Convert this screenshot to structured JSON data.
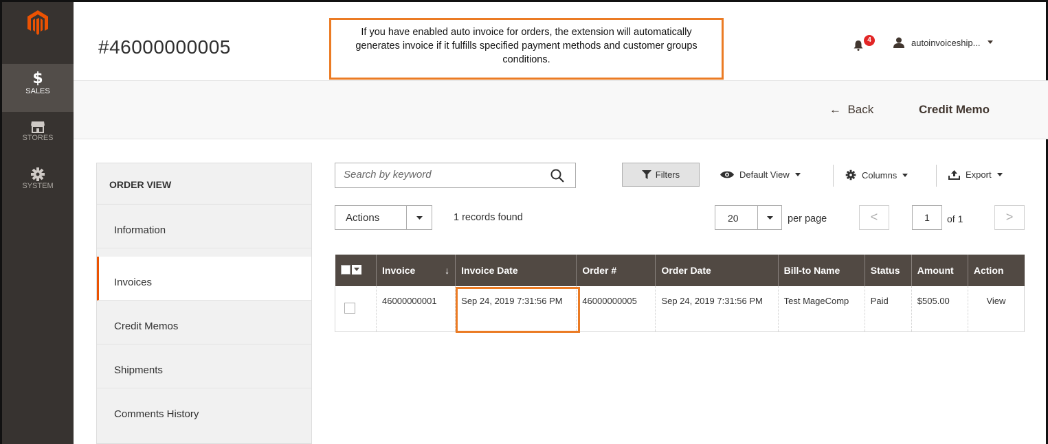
{
  "nav": {
    "items": [
      {
        "label": "SALES",
        "icon": "dollar-icon",
        "active": true
      },
      {
        "label": "STORES",
        "icon": "store-icon"
      },
      {
        "label": "SYSTEM",
        "icon": "gear-icon"
      }
    ],
    "sales_glyph": "$"
  },
  "header": {
    "title": "#46000000005",
    "notification_count": "4",
    "user": "autoinvoiceship..."
  },
  "callout": {
    "text": "If you have enabled auto invoice for orders, the extension will automatically generates invoice if it fulfills specified payment methods and customer groups conditions."
  },
  "action_bar": {
    "back_label": "Back",
    "back_arrow": "←",
    "credit_memo_label": "Credit Memo"
  },
  "side": {
    "heading": "ORDER VIEW",
    "items": [
      "Information",
      "Invoices",
      "Credit Memos",
      "Shipments",
      "Comments History"
    ],
    "active": "Invoices"
  },
  "toolbar": {
    "search_placeholder": "Search by keyword",
    "filters_label": "Filters",
    "view_label": "Default View",
    "columns_label": "Columns",
    "export_label": "Export",
    "actions_label": "Actions",
    "records_text": "1 records found",
    "per_page_value": "20",
    "per_page_label": "per page",
    "current_page": "1",
    "of_pages": "of 1",
    "prev_glyph": "<",
    "next_glyph": ">"
  },
  "table": {
    "columns": [
      "Invoice",
      "Invoice Date",
      "Order #",
      "Order Date",
      "Bill-to Name",
      "Status",
      "Amount",
      "Action"
    ],
    "sort_glyph": "↓",
    "rows": [
      {
        "invoice": "46000000001",
        "invoice_date": "Sep 24, 2019 7:31:56 PM",
        "order": "46000000005",
        "order_date": "Sep 24, 2019 7:31:56 PM",
        "bill_to": "Test MageComp",
        "status": "Paid",
        "amount": "$505.00",
        "action": "View"
      }
    ]
  },
  "colors": {
    "nav_bg": "#373330",
    "accent": "#eb5202",
    "callout_border": "#eb7b24",
    "grid_header": "#514943",
    "link": "#1979c3"
  }
}
